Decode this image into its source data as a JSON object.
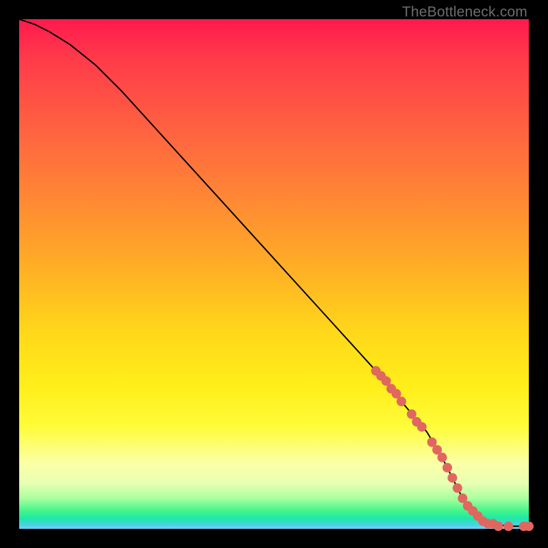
{
  "watermark": "TheBottleneck.com",
  "chart_data": {
    "type": "line",
    "title": "",
    "xlabel": "",
    "ylabel": "",
    "xlim": [
      0,
      100
    ],
    "ylim": [
      0,
      100
    ],
    "grid": false,
    "legend": false,
    "series": [
      {
        "name": "curve",
        "x": [
          0,
          3,
          6,
          10,
          15,
          20,
          30,
          40,
          50,
          60,
          70,
          75,
          80,
          83,
          85,
          87,
          90,
          93,
          96,
          100
        ],
        "y": [
          100,
          99,
          97.5,
          95,
          91,
          86,
          75,
          64,
          53,
          42,
          31,
          25,
          19,
          14,
          10,
          6,
          2.5,
          1,
          0.5,
          0.5
        ]
      }
    ],
    "markers": [
      {
        "name": "highlight-dots",
        "color": "#e0675f",
        "radius_px": 7,
        "points": [
          {
            "x": 70,
            "y": 31
          },
          {
            "x": 71,
            "y": 30
          },
          {
            "x": 72,
            "y": 29
          },
          {
            "x": 73,
            "y": 27.5
          },
          {
            "x": 74,
            "y": 26.5
          },
          {
            "x": 75,
            "y": 25
          },
          {
            "x": 77,
            "y": 22.5
          },
          {
            "x": 78,
            "y": 21
          },
          {
            "x": 79,
            "y": 20
          },
          {
            "x": 81,
            "y": 17
          },
          {
            "x": 82,
            "y": 15.5
          },
          {
            "x": 83,
            "y": 14
          },
          {
            "x": 84,
            "y": 12
          },
          {
            "x": 85,
            "y": 10
          },
          {
            "x": 86,
            "y": 8
          },
          {
            "x": 87,
            "y": 6
          },
          {
            "x": 88,
            "y": 4.5
          },
          {
            "x": 89,
            "y": 3.5
          },
          {
            "x": 90,
            "y": 2.5
          },
          {
            "x": 91,
            "y": 1.5
          },
          {
            "x": 92,
            "y": 1
          },
          {
            "x": 93,
            "y": 1
          },
          {
            "x": 94,
            "y": 0.5
          },
          {
            "x": 96,
            "y": 0.5
          },
          {
            "x": 99,
            "y": 0.5
          },
          {
            "x": 100,
            "y": 0.5
          }
        ]
      }
    ]
  }
}
